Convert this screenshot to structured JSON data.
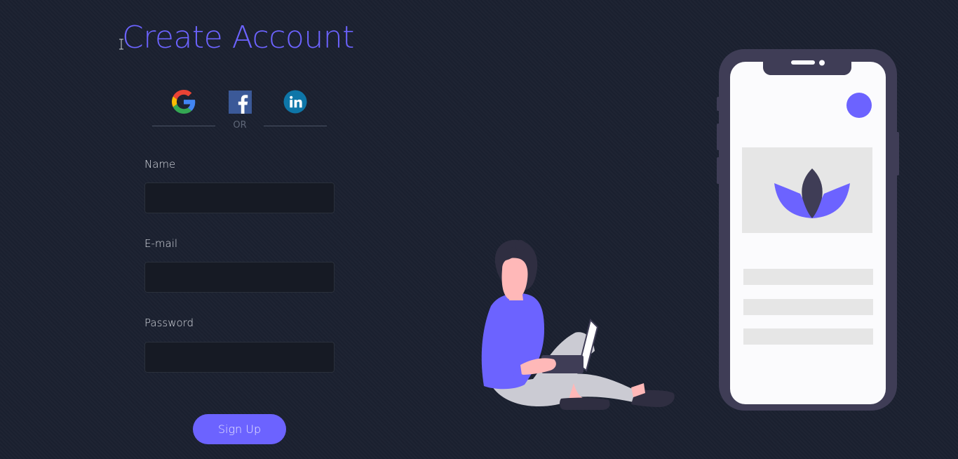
{
  "page": {
    "title": "Create Account"
  },
  "social": {
    "divider_text": "OR",
    "buttons": [
      {
        "icon": "google-icon"
      },
      {
        "icon": "facebook-icon"
      },
      {
        "icon": "linkedin-icon"
      }
    ]
  },
  "form": {
    "name_label": "Name",
    "name_value": "",
    "email_label": "E-mail",
    "email_value": "",
    "password_label": "Password",
    "password_value": "",
    "submit_label": "Sign Up"
  },
  "colors": {
    "background": "#1b2130",
    "accent": "#6c63ff",
    "input_background": "#161a24",
    "phone_frame": "#3f3d56",
    "phone_screen": "#fbfbfd"
  }
}
